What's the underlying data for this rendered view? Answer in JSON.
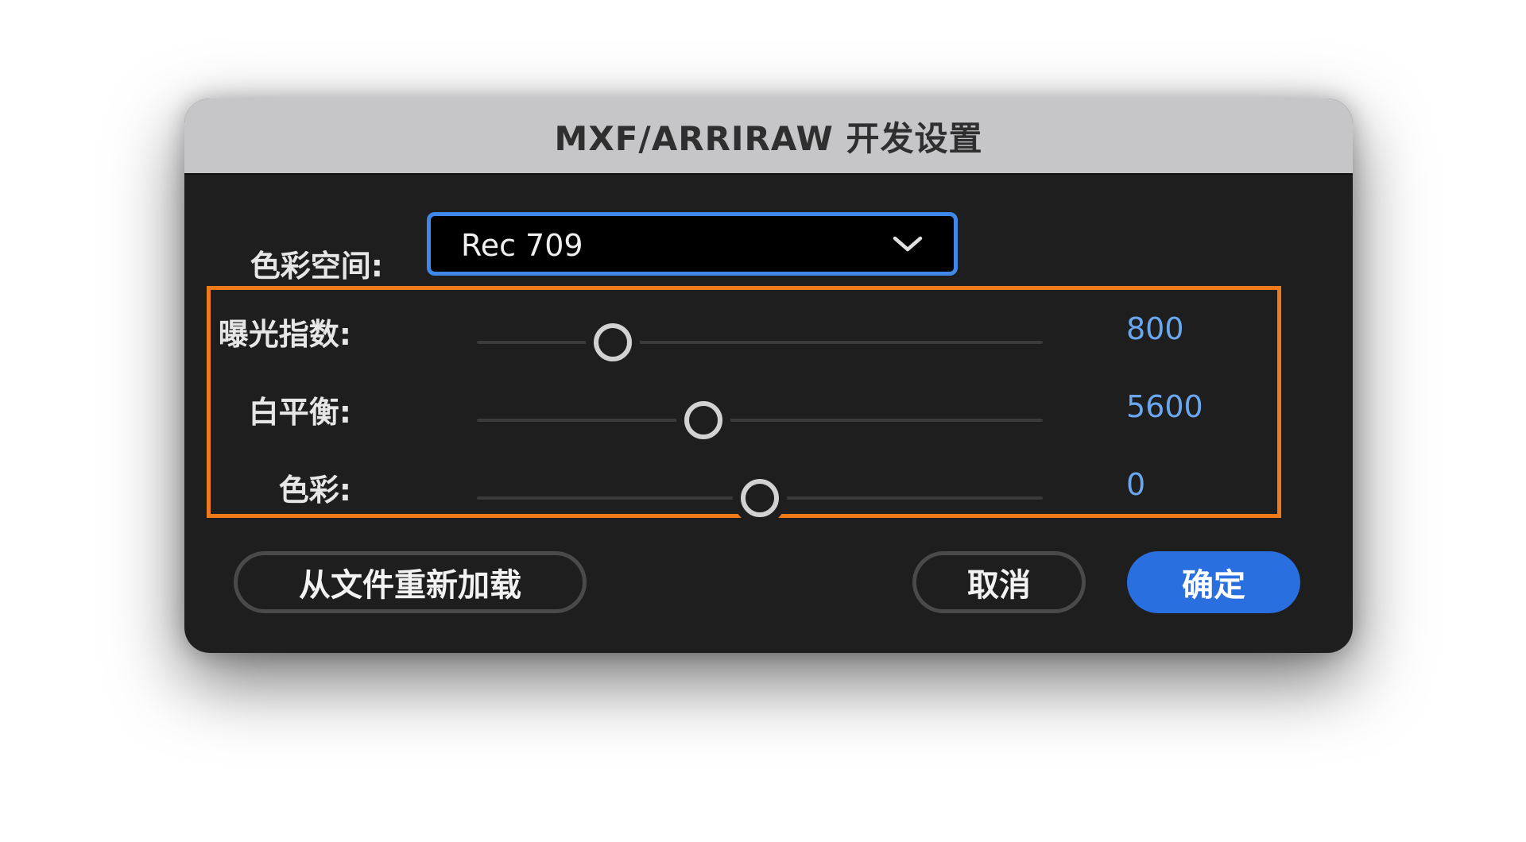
{
  "dialog": {
    "title": "MXF/ARRIRAW 开发设置"
  },
  "color_space": {
    "label": "色彩空间:",
    "selected": "Rec 709"
  },
  "sliders": [
    {
      "label": "曝光指数:",
      "value": "800",
      "position_fraction": 0.24
    },
    {
      "label": "白平衡:",
      "value": "5600",
      "position_fraction": 0.4
    },
    {
      "label": "色彩:",
      "value": "0",
      "position_fraction": 0.5
    }
  ],
  "buttons": {
    "reload": "从文件重新加载",
    "cancel": "取消",
    "ok": "确定"
  },
  "colors": {
    "accent_blue": "#2a6fe0",
    "dropdown_border": "#3f88ea",
    "value_text": "#6aa7ee",
    "highlight_orange": "#ef7a1a",
    "dialog_bg": "#1e1e1e",
    "titlebar_bg": "#c6c5c8"
  },
  "icons": {
    "dropdown": "chevron-down-icon"
  }
}
